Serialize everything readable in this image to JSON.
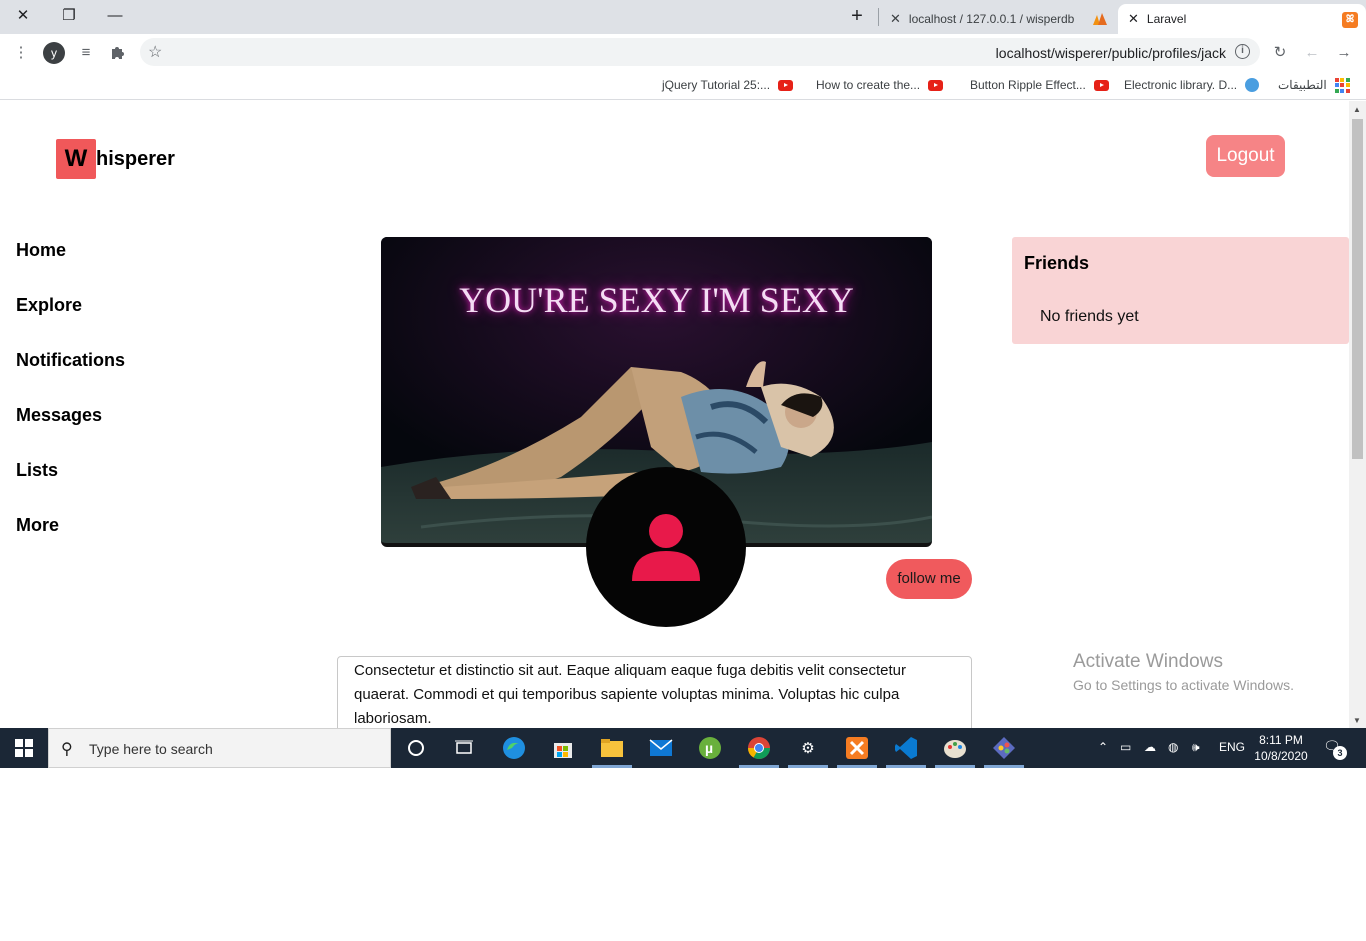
{
  "browser": {
    "tabs": [
      {
        "title": "localhost / 127.0.0.1 / wisperdb"
      },
      {
        "title": "Laravel"
      }
    ],
    "url": "localhost/wisperer/public/profiles/jack",
    "profile_initial": "y",
    "bookmarks": [
      {
        "label": "jQuery Tutorial 25:..."
      },
      {
        "label": "How to create the..."
      },
      {
        "label": "Button Ripple Effect..."
      },
      {
        "label": "Electronic library. D..."
      },
      {
        "label": "التطبيقات"
      }
    ]
  },
  "page": {
    "logo_letter": "W",
    "logo_rest": "hisperer",
    "logout_label": "Logout",
    "nav": [
      "Home",
      "Explore",
      "Notifications",
      "Messages",
      "Lists",
      "More"
    ],
    "cover_title": "YOU'RE SEXY I'M SEXY",
    "follow_label": "follow me",
    "bio": "Consectetur et distinctio sit aut. Eaque aliquam eaque fuga debitis velit consectetur quaerat. Commodi et qui temporibus sapiente voluptas minima. Voluptas hic culpa laboriosam.",
    "friends_title": "Friends",
    "friends_empty": "No friends yet",
    "accent_color": "#f0585a",
    "avatar_icon_color": "#e8194a"
  },
  "watermark": {
    "line1": "Activate Windows",
    "line2": "Go to Settings to activate Windows."
  },
  "taskbar": {
    "search_placeholder": "Type here to search",
    "language": "ENG",
    "time": "8:11 PM",
    "date": "10/8/2020",
    "notification_count": "3"
  }
}
